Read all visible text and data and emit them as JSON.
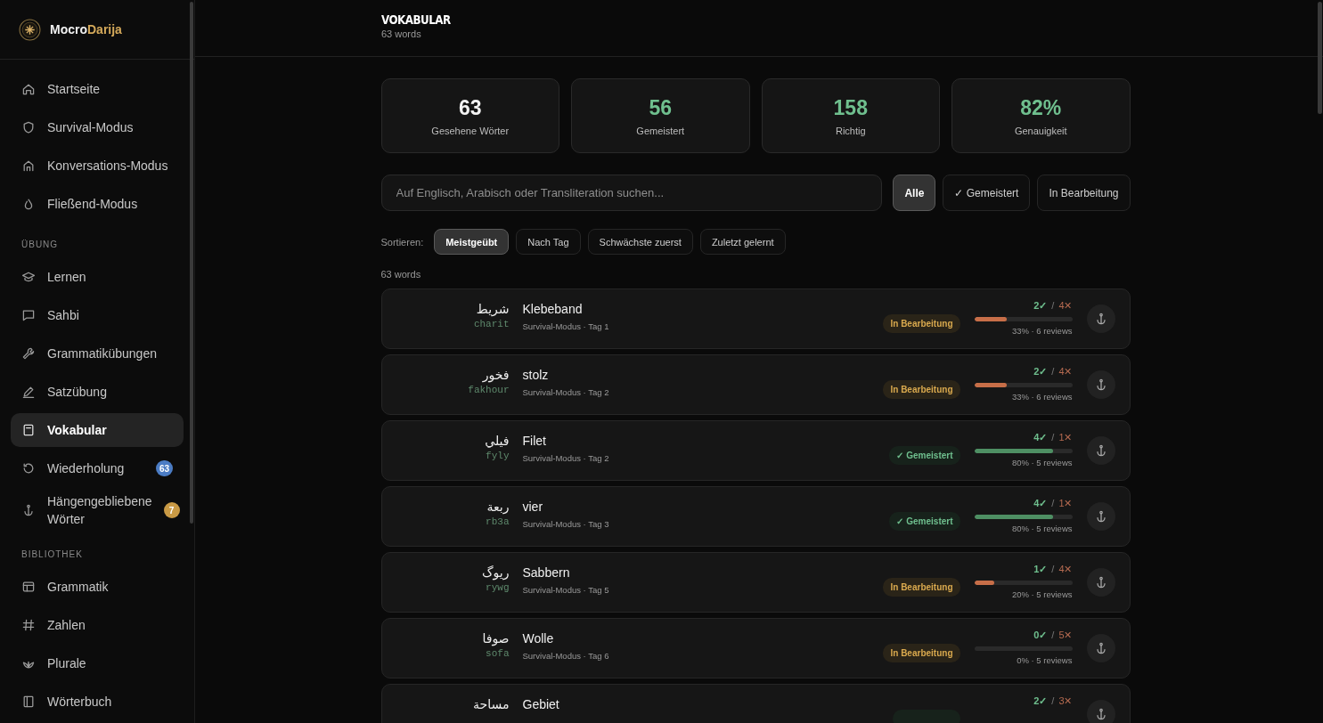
{
  "brand": {
    "first": "Mocro",
    "second": "Darija"
  },
  "sidebar": {
    "groups": [
      {
        "items": [
          {
            "label": "Startseite",
            "selected": false
          },
          {
            "label": "Survival-Modus",
            "selected": false
          },
          {
            "label": "Konversations-Modus",
            "selected": false
          },
          {
            "label": "Fließend-Modus",
            "selected": false
          }
        ]
      },
      {
        "heading": "ÜBUNG",
        "items": [
          {
            "label": "Lernen",
            "selected": false
          },
          {
            "label": "Sahbi",
            "selected": false
          },
          {
            "label": "Grammatikübungen",
            "selected": false
          },
          {
            "label": "Satzübung",
            "selected": false
          },
          {
            "label": "Vokabular",
            "selected": true
          },
          {
            "label": "Wiederholung",
            "selected": false,
            "badge": "63",
            "color": "#4b7cc4"
          },
          {
            "label": "Hängengebliebene Wörter",
            "selected": false,
            "badge": "7",
            "color": "#c99a45"
          }
        ]
      },
      {
        "heading": "BIBLIOTHEK",
        "items": [
          {
            "label": "Grammatik",
            "selected": false
          },
          {
            "label": "Zahlen",
            "selected": false
          },
          {
            "label": "Plurale",
            "selected": false
          },
          {
            "label": "Wörterbuch",
            "selected": false
          }
        ]
      }
    ]
  },
  "header": {
    "title": "VOKABULAR",
    "subtitle": "63 words"
  },
  "stats": [
    {
      "value": "63",
      "label": "Gesehene Wörter",
      "color": "#f2f2f2"
    },
    {
      "value": "56",
      "label": "Gemeistert",
      "color": "#6fbf8e"
    },
    {
      "value": "158",
      "label": "Richtig",
      "color": "#6fbf8e"
    },
    {
      "value": "82%",
      "label": "Genauigkeit",
      "color": "#6fbf8e"
    }
  ],
  "search": {
    "placeholder": "Auf Englisch, Arabisch oder Transliteration suchen..."
  },
  "filters": [
    {
      "label": "Alle",
      "selected": true
    },
    {
      "label": "✓ Gemeistert",
      "selected": false
    },
    {
      "label": "In Bearbeitung",
      "selected": false
    }
  ],
  "sort": {
    "label": "Sortieren:",
    "options": [
      {
        "label": "Meistgeübt",
        "selected": true
      },
      {
        "label": "Nach Tag",
        "selected": false
      },
      {
        "label": "Schwächste zuerst",
        "selected": false
      },
      {
        "label": "Zuletzt gelernt",
        "selected": false
      }
    ]
  },
  "count": "63 words",
  "words": [
    {
      "arabic": "شريط",
      "translit": "charit",
      "word": "Klebeband",
      "meta": "Survival-Modus · Tag 1",
      "kind": "learning",
      "status": "In Bearbeitung",
      "correct": "2✓",
      "separator": "/",
      "wrong": "4✕",
      "level": 0.33,
      "reading": "33% · 6 reviews"
    },
    {
      "arabic": "فخور",
      "translit": "fakhour",
      "word": "stolz",
      "meta": "Survival-Modus · Tag 2",
      "kind": "learning",
      "status": "In Bearbeitung",
      "correct": "2✓",
      "separator": "/",
      "wrong": "4✕",
      "level": 0.33,
      "reading": "33% · 6 reviews"
    },
    {
      "arabic": "فيلي",
      "translit": "fyly",
      "word": "Filet",
      "meta": "Survival-Modus · Tag 2",
      "kind": "mastered",
      "status": "✓ Gemeistert",
      "correct": "4✓",
      "separator": "/",
      "wrong": "1✕",
      "level": 0.8,
      "reading": "80% · 5 reviews"
    },
    {
      "arabic": "ربعة",
      "translit": "rb3a",
      "word": "vier",
      "meta": "Survival-Modus · Tag 3",
      "kind": "mastered",
      "status": "✓ Gemeistert",
      "correct": "4✓",
      "separator": "/",
      "wrong": "1✕",
      "level": 0.8,
      "reading": "80% · 5 reviews"
    },
    {
      "arabic": "ريوگ",
      "translit": "rywg",
      "word": "Sabbern",
      "meta": "Survival-Modus · Tag 5",
      "kind": "learning",
      "status": "In Bearbeitung",
      "correct": "1✓",
      "separator": "/",
      "wrong": "4✕",
      "level": 0.2,
      "reading": "20% · 5 reviews"
    },
    {
      "arabic": "صوفا",
      "translit": "sofa",
      "word": "Wolle",
      "meta": "Survival-Modus · Tag 6",
      "kind": "learning",
      "status": "In Bearbeitung",
      "correct": "0✓",
      "separator": "/",
      "wrong": "5✕",
      "level": 0,
      "reading": "0% · 5 reviews"
    },
    {
      "arabic": "مساحة",
      "word": "Gebiet",
      "kind": "mastered",
      "correct": "2✓",
      "separator": "/",
      "wrong": "3✕"
    }
  ]
}
